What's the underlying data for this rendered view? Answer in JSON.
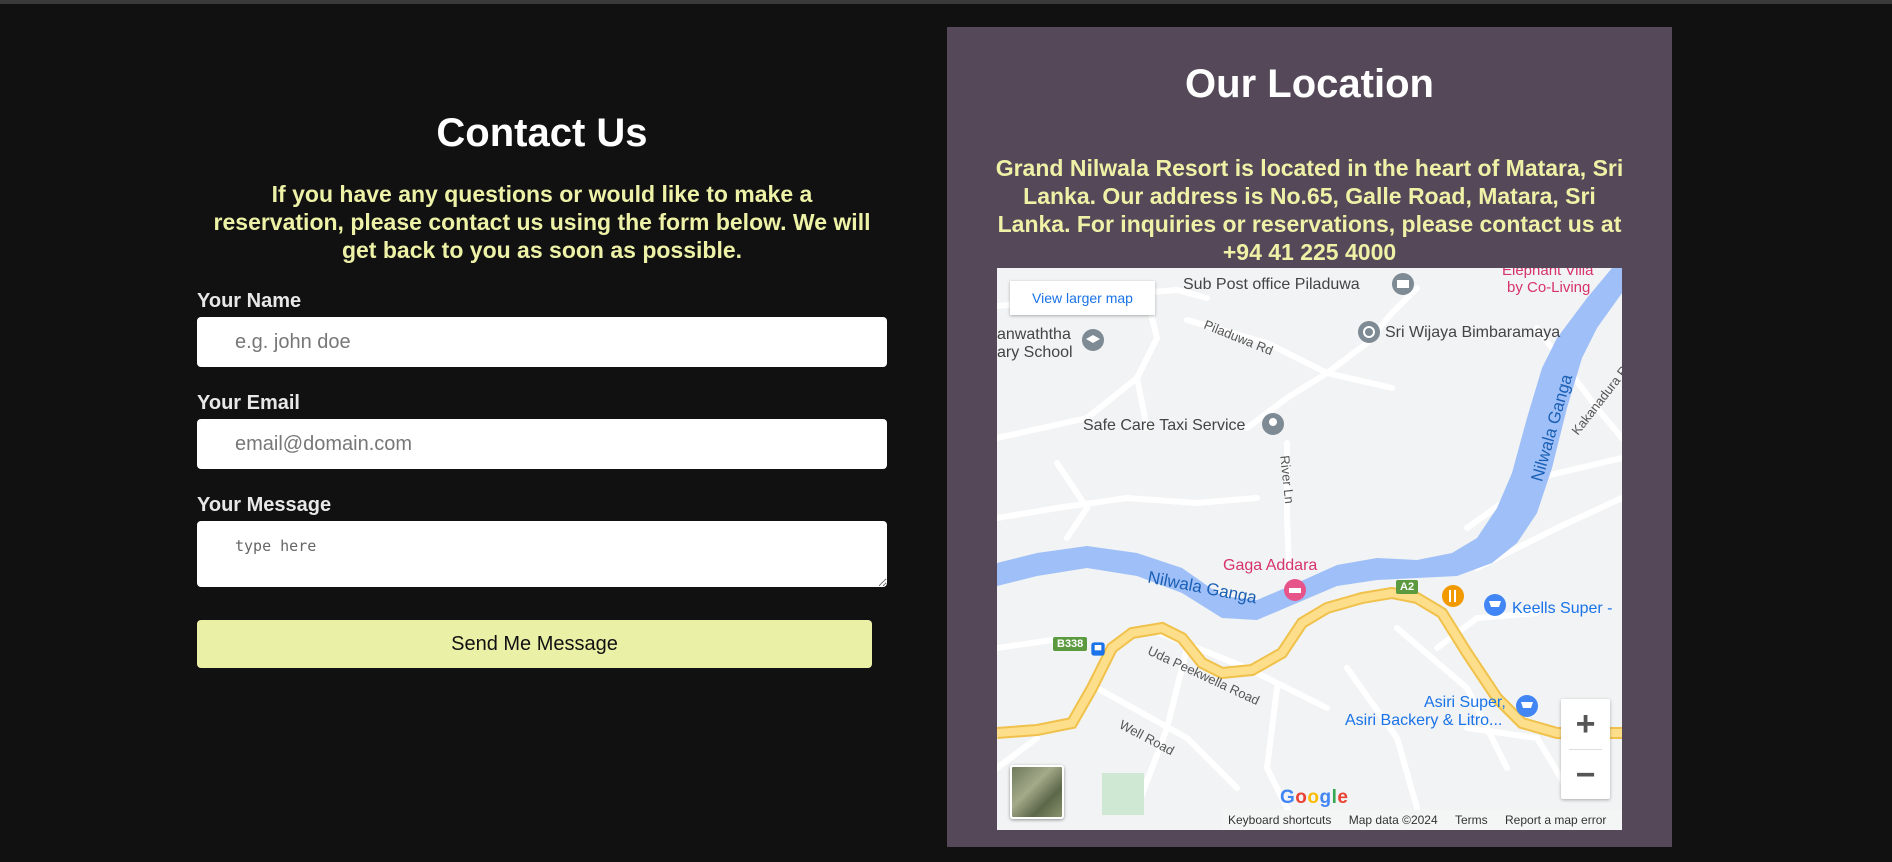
{
  "contact": {
    "title": "Contact Us",
    "intro": "If you have any questions or would like to make a reservation, please contact us using the form below. We will get back to you as soon as possible.",
    "name_label": "Your Name",
    "name_placeholder": "e.g. john doe",
    "email_label": "Your Email",
    "email_placeholder": "email@domain.com",
    "message_label": "Your Message",
    "message_placeholder": "type here",
    "send_label": "Send Me Message"
  },
  "location": {
    "title": "Our Location",
    "address": "Grand Nilwala Resort is located in the heart of Matara, Sri Lanka. Our address is No.65, Galle Road, Matara, Sri Lanka. For inquiries or reservations, please contact us at +94 41 225 4000"
  },
  "map": {
    "view_larger": "View larger map",
    "places": {
      "sub_post": "Sub Post office Piladuwa",
      "elephant_1": "Elephant Villa",
      "elephant_2": "by Co-Living",
      "school_1": "anwaththa",
      "school_2": "ary School",
      "wijaya": "Sri Wijaya Bimbaramaya",
      "taxi": "Safe Care Taxi Service",
      "gaga": "Gaga Addara",
      "keells": "Keells Super -",
      "asiri_1": "Asiri Super,",
      "asiri_2": "Asiri Backery & Litro..."
    },
    "roads": {
      "piladuwa": "Piladuwa Rd",
      "river_ln": "River Ln",
      "kakanadura": "Kakanadura Rd",
      "uda": "Uda Peekwella Road",
      "well": "Well Road",
      "b338": "B338",
      "a2": "A2"
    },
    "river": "Nilwala Ganga",
    "zoom_in": "+",
    "zoom_out": "−",
    "google": "Google",
    "footer": {
      "shortcuts": "Keyboard shortcuts",
      "data": "Map data ©2024",
      "terms": "Terms",
      "report": "Report a map error"
    }
  },
  "colors": {
    "background": "#111111",
    "accent_yellow": "#eef2a6",
    "panel": "#554959",
    "river": "#9ebff7",
    "road_major": "#fcd46f"
  }
}
